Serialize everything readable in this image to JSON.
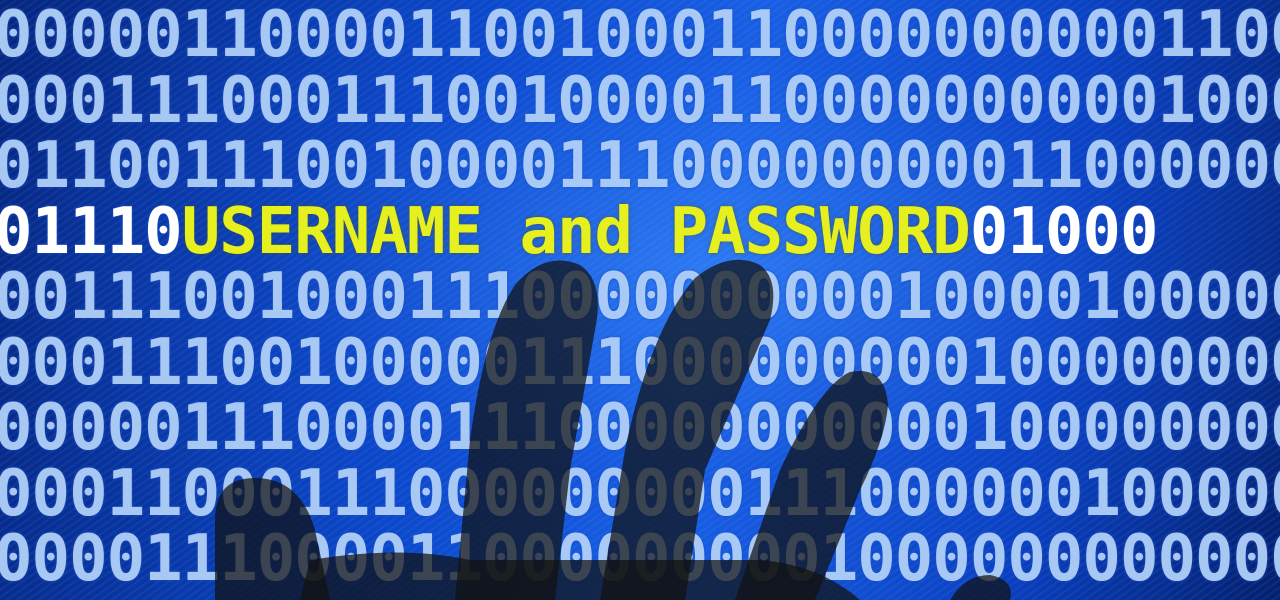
{
  "image": {
    "caption_parts": [
      "USERNAME",
      "and",
      "PASSWORD"
    ],
    "rows": [
      "00000110000110010001100000000001100",
      "00011100011100100001100000000001000",
      "01100111001000011100000000011000000",
      "00111001000111000000000010000100000",
      "00011100100000111000000000100000000",
      "00000111000011100000000000100000000",
      "00011000111000000000111000000100000",
      "00001110000110000000001000000000000"
    ],
    "highlight_row": {
      "prefix": "01110",
      "suffix": "01000"
    },
    "colors": {
      "background": "#0b47c9",
      "digits": "#c8e4ff",
      "caption": "#e6f01e",
      "hand": "#111111"
    }
  }
}
